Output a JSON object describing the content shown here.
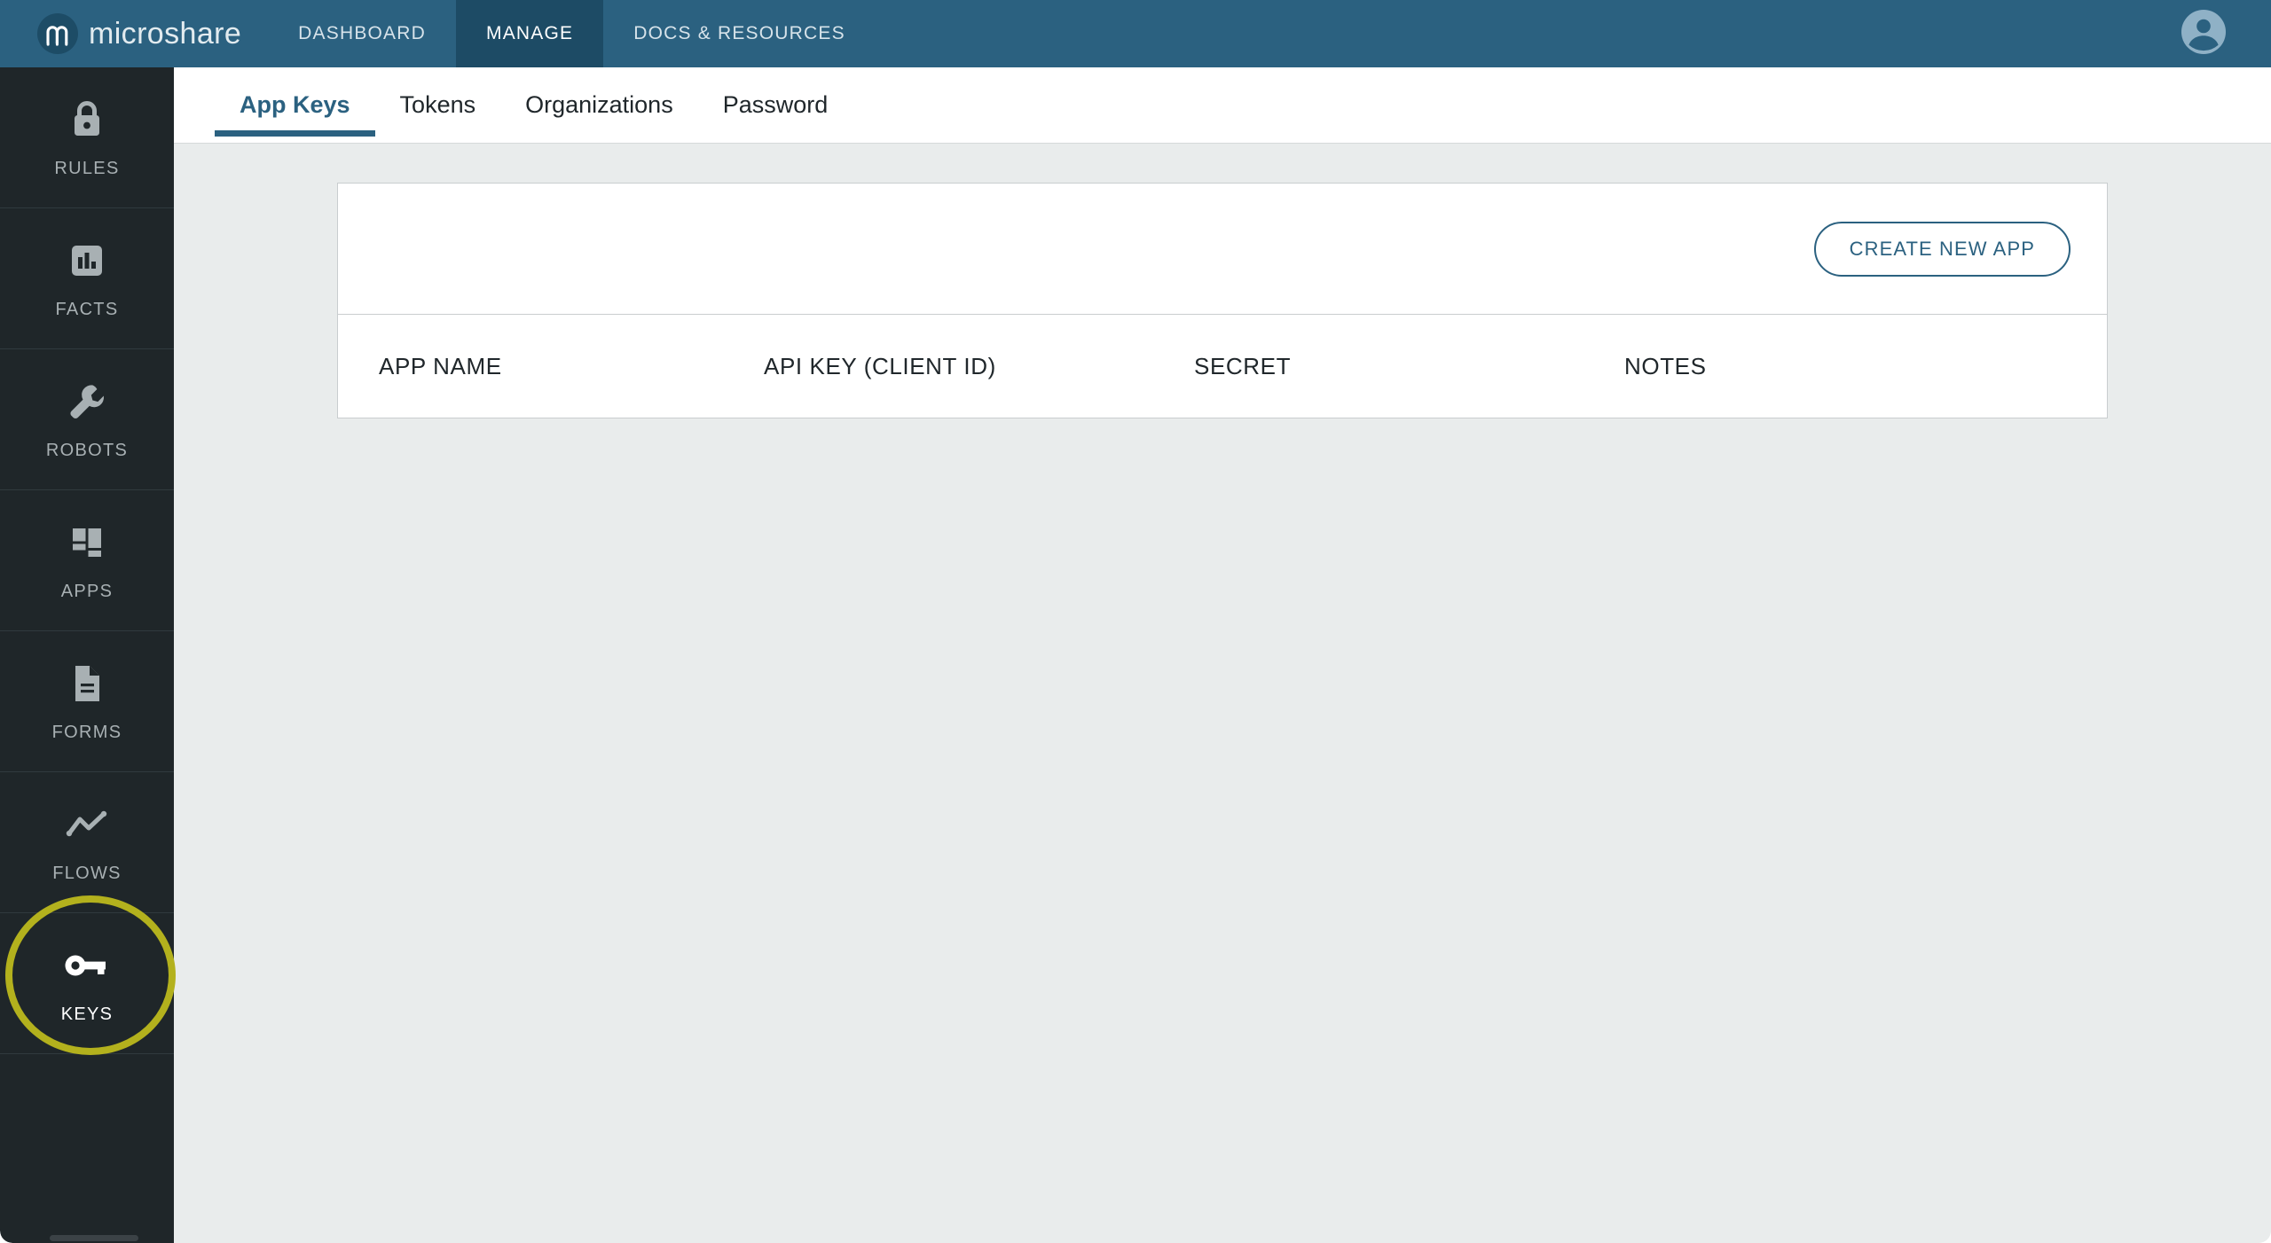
{
  "header": {
    "brand_name": "microshare",
    "brand_logo_icon": "microshare-m-logo-icon",
    "nav": [
      {
        "label": "DASHBOARD",
        "active": false
      },
      {
        "label": "MANAGE",
        "active": true
      },
      {
        "label": "DOCS & RESOURCES",
        "active": false
      }
    ],
    "avatar_icon": "user-account-icon",
    "bg_color": "#2b6180",
    "active_bg_color": "#1d4b65"
  },
  "sidebar": {
    "bg_color": "#1f2629",
    "items": [
      {
        "label": "RULES",
        "icon": "lock-icon",
        "active": false
      },
      {
        "label": "FACTS",
        "icon": "bar-chart-icon",
        "active": false
      },
      {
        "label": "ROBOTS",
        "icon": "wrench-icon",
        "active": false
      },
      {
        "label": "APPS",
        "icon": "grid-tiles-icon",
        "active": false
      },
      {
        "label": "FORMS",
        "icon": "document-icon",
        "active": false
      },
      {
        "label": "FLOWS",
        "icon": "line-chart-icon",
        "active": false
      },
      {
        "label": "KEYS",
        "icon": "key-icon",
        "active": true
      }
    ],
    "annotation": {
      "target_label": "KEYS",
      "shape": "circle",
      "color": "#b3b11d"
    }
  },
  "main": {
    "tabs": [
      {
        "label": "App Keys",
        "active": true
      },
      {
        "label": "Tokens",
        "active": false
      },
      {
        "label": "Organizations",
        "active": false
      },
      {
        "label": "Password",
        "active": false
      }
    ],
    "accent_color": "#2b6180",
    "toolbar": {
      "create_label": "CREATE NEW APP"
    },
    "table": {
      "columns": [
        "APP NAME",
        "API KEY (CLIENT ID)",
        "SECRET",
        "NOTES"
      ],
      "rows": []
    }
  }
}
